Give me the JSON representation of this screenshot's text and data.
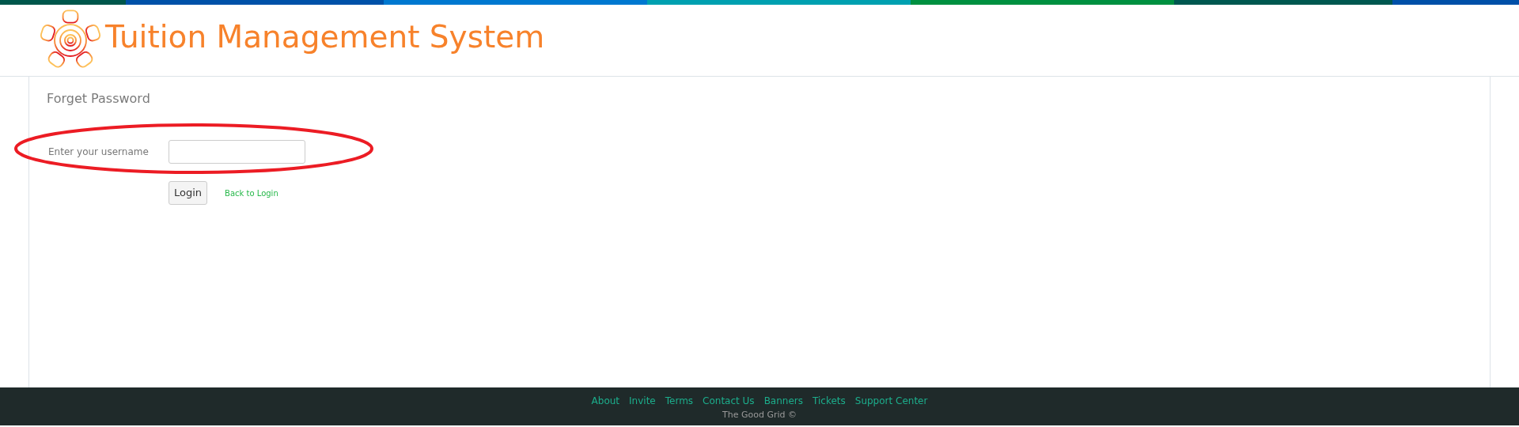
{
  "header": {
    "title": "Tuition Management System"
  },
  "form": {
    "title": "Forget Password",
    "field_label": "Enter your username",
    "submit_button": "Login",
    "back_link": "Back to Login"
  },
  "annotation": {
    "kind": "ellipse",
    "color": "#ec1c24"
  },
  "footer": {
    "links": [
      "About",
      "Invite",
      "Terms",
      "Contact Us",
      "Banners",
      "Tickets",
      "Support Center"
    ],
    "copyright": "The Good Grid ©"
  }
}
